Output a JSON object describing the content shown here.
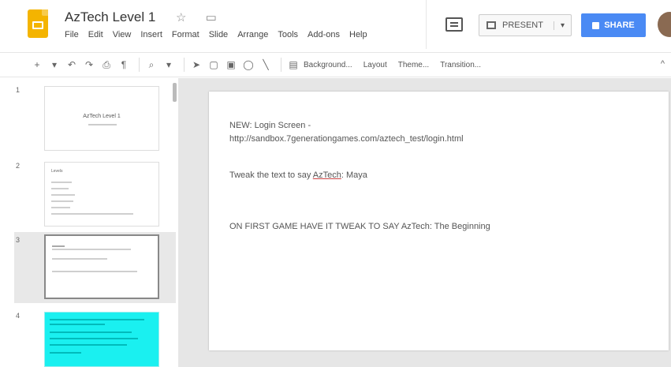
{
  "app": {
    "title": "AzTech Level 1",
    "title_icons": "☆ ▭",
    "menu": [
      "File",
      "Edit",
      "View",
      "Insert",
      "Format",
      "Slide",
      "Arrange",
      "Tools",
      "Add-ons",
      "Help"
    ],
    "present_label": "PRESENT",
    "share_label": "SHARE",
    "brand_color": "#f4b400",
    "accent_color": "#4a8af4"
  },
  "toolbar": {
    "icons": [
      "add-icon",
      "chevron-down-icon",
      "undo-icon",
      "redo-icon",
      "print-icon",
      "paint-format-icon",
      "zoom-icon",
      "select-icon",
      "text-box-icon",
      "image-icon",
      "shape-icon",
      "line-icon",
      "comment-icon"
    ],
    "background_label": "Background...",
    "layout_label": "Layout",
    "theme_label": "Theme...",
    "transition_label": "Transition...",
    "collapse_label": "^"
  },
  "slides": [
    {
      "num": "1",
      "title": "AzTech Level 1"
    },
    {
      "num": "2",
      "title": "Levels"
    },
    {
      "num": "3",
      "title": ""
    },
    {
      "num": "4",
      "title": ""
    }
  ],
  "current_slide": {
    "line1": "NEW: Login Screen -",
    "line2": "http://sandbox.7generationgames.com/aztech_test/login.html",
    "line3_prefix": "Tweak the text to say ",
    "line3_word": "AzTech",
    "line3_suffix": ": Maya",
    "line4": "ON FIRST GAME HAVE IT TWEAK TO SAY AzTech: The Beginning"
  }
}
